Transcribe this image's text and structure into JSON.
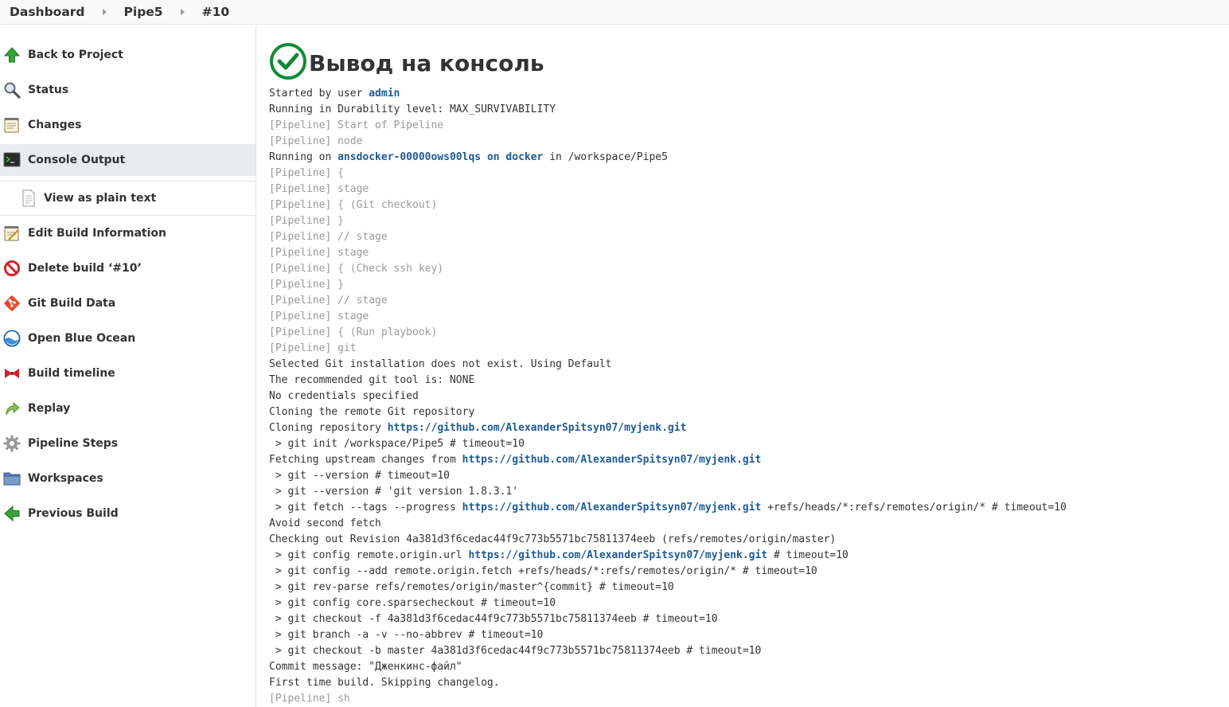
{
  "breadcrumbs": [
    "Dashboard",
    "Pipe5",
    "#10"
  ],
  "sidebar": {
    "items": [
      {
        "label": "Back to Project",
        "icon": "up-arrow-icon"
      },
      {
        "label": "Status",
        "icon": "magnifier-icon"
      },
      {
        "label": "Changes",
        "icon": "notepad-icon"
      },
      {
        "label": "Console Output",
        "icon": "terminal-icon"
      },
      {
        "label": "View as plain text",
        "icon": "document-icon"
      },
      {
        "label": "Edit Build Information",
        "icon": "notepad-edit-icon"
      },
      {
        "label": "Delete build ‘#10’",
        "icon": "no-entry-icon"
      },
      {
        "label": "Git Build Data",
        "icon": "git-icon"
      },
      {
        "label": "Open Blue Ocean",
        "icon": "blue-ocean-icon"
      },
      {
        "label": "Build timeline",
        "icon": "bowtie-icon"
      },
      {
        "label": "Replay",
        "icon": "replay-arrow-icon"
      },
      {
        "label": "Pipeline Steps",
        "icon": "gear-icon"
      },
      {
        "label": "Workspaces",
        "icon": "folder-icon"
      },
      {
        "label": "Previous Build",
        "icon": "left-arrow-icon"
      }
    ]
  },
  "main": {
    "title": "Вывод на консоль",
    "status_icon": "success-check-icon",
    "lines": [
      [
        {
          "t": "Started by user "
        },
        {
          "t": "admin",
          "k": "link"
        }
      ],
      [
        {
          "t": "Running in Durability level: MAX_SURVIVABILITY"
        }
      ],
      [
        {
          "t": "[Pipeline] Start of Pipeline",
          "k": "pipeline"
        }
      ],
      [
        {
          "t": "[Pipeline] node",
          "k": "pipeline"
        }
      ],
      [
        {
          "t": "Running on "
        },
        {
          "t": "ansdocker-00000ows00lqs",
          "k": "link"
        },
        {
          "t": " "
        },
        {
          "t": "on docker",
          "k": "link"
        },
        {
          "t": " in /workspace/Pipe5"
        }
      ],
      [
        {
          "t": "[Pipeline] {",
          "k": "pipeline"
        }
      ],
      [
        {
          "t": "[Pipeline] stage",
          "k": "pipeline"
        }
      ],
      [
        {
          "t": "[Pipeline] { (Git checkout)",
          "k": "pipeline"
        }
      ],
      [
        {
          "t": "[Pipeline] }",
          "k": "pipeline"
        }
      ],
      [
        {
          "t": "[Pipeline] // stage",
          "k": "pipeline"
        }
      ],
      [
        {
          "t": "[Pipeline] stage",
          "k": "pipeline"
        }
      ],
      [
        {
          "t": "[Pipeline] { (Check ssh key)",
          "k": "pipeline"
        }
      ],
      [
        {
          "t": "[Pipeline] }",
          "k": "pipeline"
        }
      ],
      [
        {
          "t": "[Pipeline] // stage",
          "k": "pipeline"
        }
      ],
      [
        {
          "t": "[Pipeline] stage",
          "k": "pipeline"
        }
      ],
      [
        {
          "t": "[Pipeline] { (Run playbook)",
          "k": "pipeline"
        }
      ],
      [
        {
          "t": "[Pipeline] git",
          "k": "pipeline"
        }
      ],
      [
        {
          "t": "Selected Git installation does not exist. Using Default"
        }
      ],
      [
        {
          "t": "The recommended git tool is: NONE"
        }
      ],
      [
        {
          "t": "No credentials specified"
        }
      ],
      [
        {
          "t": "Cloning the remote Git repository"
        }
      ],
      [
        {
          "t": "Cloning repository "
        },
        {
          "t": "https://github.com/AlexanderSpitsyn07/myjenk.git",
          "k": "link"
        }
      ],
      [
        {
          "t": " > git init /workspace/Pipe5 # timeout=10"
        }
      ],
      [
        {
          "t": "Fetching upstream changes from "
        },
        {
          "t": "https://github.com/AlexanderSpitsyn07/myjenk.git",
          "k": "link"
        }
      ],
      [
        {
          "t": " > git --version # timeout=10"
        }
      ],
      [
        {
          "t": " > git --version # 'git version 1.8.3.1'"
        }
      ],
      [
        {
          "t": " > git fetch --tags --progress "
        },
        {
          "t": "https://github.com/AlexanderSpitsyn07/myjenk.git",
          "k": "link"
        },
        {
          "t": " +refs/heads/*:refs/remotes/origin/* # timeout=10"
        }
      ],
      [
        {
          "t": "Avoid second fetch"
        }
      ],
      [
        {
          "t": "Checking out Revision 4a381d3f6cedac44f9c773b5571bc75811374eeb (refs/remotes/origin/master)"
        }
      ],
      [
        {
          "t": " > git config remote.origin.url "
        },
        {
          "t": "https://github.com/AlexanderSpitsyn07/myjenk.git",
          "k": "link"
        },
        {
          "t": " # timeout=10"
        }
      ],
      [
        {
          "t": " > git config --add remote.origin.fetch +refs/heads/*:refs/remotes/origin/* # timeout=10"
        }
      ],
      [
        {
          "t": " > git rev-parse refs/remotes/origin/master^{commit} # timeout=10"
        }
      ],
      [
        {
          "t": " > git config core.sparsecheckout # timeout=10"
        }
      ],
      [
        {
          "t": " > git checkout -f 4a381d3f6cedac44f9c773b5571bc75811374eeb # timeout=10"
        }
      ],
      [
        {
          "t": " > git branch -a -v --no-abbrev # timeout=10"
        }
      ],
      [
        {
          "t": " > git checkout -b master 4a381d3f6cedac44f9c773b5571bc75811374eeb # timeout=10"
        }
      ],
      [
        {
          "t": "Commit message: \"Дженкинс-файл\""
        }
      ],
      [
        {
          "t": "First time build. Skipping changelog."
        }
      ],
      [
        {
          "t": "[Pipeline] sh",
          "k": "pipeline"
        }
      ]
    ]
  },
  "colors": {
    "link": "#1e5a96",
    "pipeline_text": "#9a9a9a",
    "success_green": "#138a36",
    "active_item_bg": "#e9ecef"
  }
}
